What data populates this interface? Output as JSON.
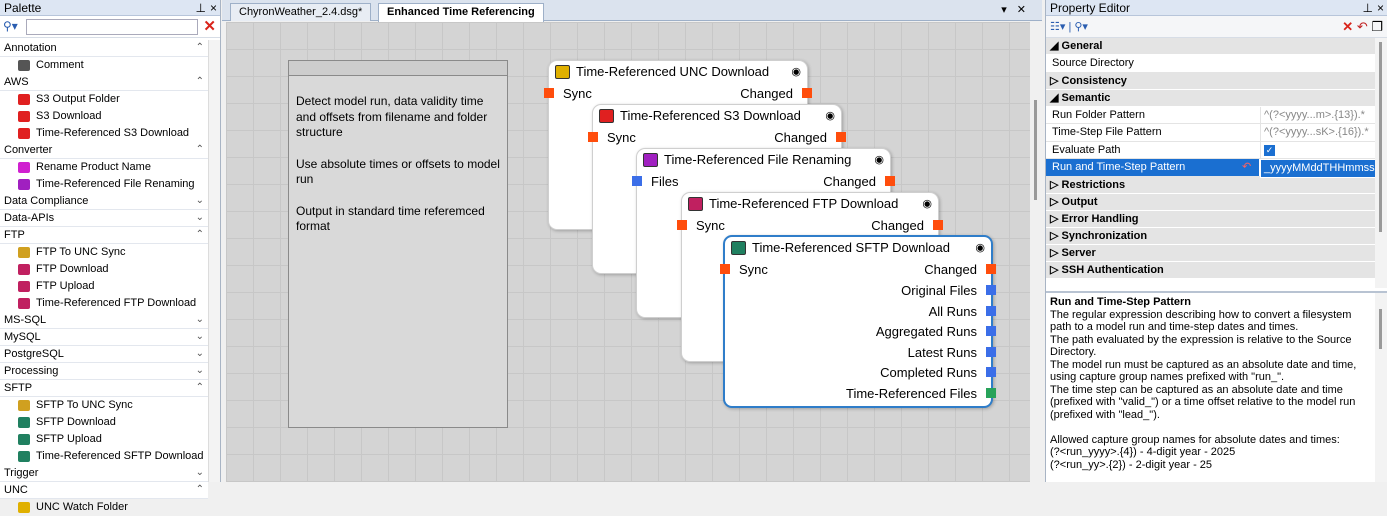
{
  "palette": {
    "title": "Palette",
    "search_placeholder": "",
    "categories": [
      {
        "name": "Annotation",
        "expanded": true,
        "items": [
          {
            "label": "Comment",
            "icon": "comment-icon",
            "color": "#555555"
          }
        ]
      },
      {
        "name": "AWS",
        "expanded": true,
        "items": [
          {
            "label": "S3 Output Folder",
            "icon": "s3-output-icon",
            "color": "#e02020"
          },
          {
            "label": "S3 Download",
            "icon": "s3-download-icon",
            "color": "#e02020"
          },
          {
            "label": "Time-Referenced S3 Download",
            "icon": "s3-time-icon",
            "color": "#e02020"
          }
        ]
      },
      {
        "name": "Converter",
        "expanded": true,
        "items": [
          {
            "label": "Rename Product Name",
            "icon": "rename-icon",
            "color": "#d020d0"
          },
          {
            "label": "Time-Referenced File Renaming",
            "icon": "rename-time-icon",
            "color": "#a020c0"
          }
        ]
      },
      {
        "name": "Data Compliance",
        "expanded": false,
        "items": []
      },
      {
        "name": "Data-APIs",
        "expanded": false,
        "items": []
      },
      {
        "name": "FTP",
        "expanded": true,
        "items": [
          {
            "label": "FTP To UNC Sync",
            "icon": "ftp-sync-icon",
            "color": "#d0a020"
          },
          {
            "label": "FTP Download",
            "icon": "ftp-download-icon",
            "color": "#c02060"
          },
          {
            "label": "FTP Upload",
            "icon": "ftp-upload-icon",
            "color": "#c02060"
          },
          {
            "label": "Time-Referenced FTP Download",
            "icon": "ftp-time-icon",
            "color": "#c02060"
          }
        ]
      },
      {
        "name": "MS-SQL",
        "expanded": false,
        "items": []
      },
      {
        "name": "MySQL",
        "expanded": false,
        "items": []
      },
      {
        "name": "PostgreSQL",
        "expanded": false,
        "items": []
      },
      {
        "name": "Processing",
        "expanded": false,
        "items": []
      },
      {
        "name": "SFTP",
        "expanded": true,
        "items": [
          {
            "label": "SFTP To UNC Sync",
            "icon": "sftp-sync-icon",
            "color": "#d0a020"
          },
          {
            "label": "SFTP Download",
            "icon": "sftp-download-icon",
            "color": "#208060"
          },
          {
            "label": "SFTP Upload",
            "icon": "sftp-upload-icon",
            "color": "#208060"
          },
          {
            "label": "Time-Referenced SFTP Download",
            "icon": "sftp-time-icon",
            "color": "#208060"
          }
        ]
      },
      {
        "name": "Trigger",
        "expanded": false,
        "items": []
      },
      {
        "name": "UNC",
        "expanded": true,
        "items": [
          {
            "label": "UNC Watch Folder",
            "icon": "unc-watch-icon",
            "color": "#e0b000"
          }
        ]
      }
    ]
  },
  "tabs": [
    {
      "label": "ChyronWeather_2.4.dsg*",
      "active": false
    },
    {
      "label": "Enhanced Time Referencing",
      "active": true
    }
  ],
  "comment": {
    "paragraphs": [
      "Detect model run, data validity time and offsets from filename and folder structure",
      "Use absolute times or offsets to model run",
      "Output in standard time referemced format"
    ]
  },
  "nodes": [
    {
      "title": "Time-Referenced UNC Download",
      "icon_color": "#e0b000",
      "in": {
        "label": "Sync",
        "color": "#ff4d0c"
      },
      "out": "Changed"
    },
    {
      "title": "Time-Referenced S3 Download",
      "icon_color": "#e02020",
      "in": {
        "label": "Sync",
        "color": "#ff4d0c"
      },
      "out": "Changed"
    },
    {
      "title": "Time-Referenced File Renaming",
      "icon_color": "#a020c0",
      "in": {
        "label": "Files",
        "color": "#3b6ee8"
      },
      "out": "Changed"
    },
    {
      "title": "Time-Referenced FTP Download",
      "icon_color": "#c02060",
      "in": {
        "label": "Sync",
        "color": "#ff4d0c"
      },
      "out": "Changed"
    },
    {
      "title": "Time-Referenced SFTP Download",
      "icon_color": "#208060",
      "in": {
        "label": "Sync",
        "color": "#ff4d0c"
      },
      "out": "Changed",
      "extra_outputs": [
        "Original Files",
        "All Runs",
        "Aggregated Runs",
        "Latest Runs",
        "Completed Runs",
        "Time-Referenced Files"
      ]
    }
  ],
  "property_editor": {
    "title": "Property Editor",
    "rows": [
      {
        "type": "cat",
        "label": "General",
        "expanded": true
      },
      {
        "type": "prop",
        "label": "Source Directory",
        "value": ""
      },
      {
        "type": "cat",
        "label": "Consistency",
        "expanded": false
      },
      {
        "type": "cat",
        "label": "Semantic",
        "expanded": true
      },
      {
        "type": "prop",
        "label": "Run Folder Pattern",
        "value": "^(?<yyyy...m>.{13}).*"
      },
      {
        "type": "prop",
        "label": "Time-Step File Pattern",
        "value": "^(?<yyyy...sK>.{16}).*"
      },
      {
        "type": "prop",
        "label": "Evaluate Path",
        "value": "",
        "checkbox": true
      },
      {
        "type": "prop",
        "label": "Run and Time-Step Pattern",
        "value": "_yyyyMMddTHHmmssK",
        "selected": true
      },
      {
        "type": "cat",
        "label": "Restrictions",
        "expanded": false
      },
      {
        "type": "cat",
        "label": "Output",
        "expanded": false
      },
      {
        "type": "cat",
        "label": "Error Handling",
        "expanded": false
      },
      {
        "type": "cat",
        "label": "Synchronization",
        "expanded": false
      },
      {
        "type": "cat",
        "label": "Server",
        "expanded": false
      },
      {
        "type": "cat",
        "label": "SSH Authentication",
        "expanded": false
      }
    ],
    "description": {
      "title": "Run and Time-Step Pattern",
      "lines": [
        "The regular expression describing how to convert a filesystem path to a model run and time-step dates and times.",
        "The path evaluated by the expression is relative to the Source Directory.",
        "The model run must be captured as an absolute date and time, using capture group names prefixed with \"run_\".",
        "The time step can be captured as an absolute date and time (prefixed with \"valid_\") or a time offset relative to the model run (prefixed with \"lead_\").",
        "",
        "Allowed capture group names for absolute dates and times:",
        "(?<run_yyyy>.{4}) - 4-digit year - 2025",
        "(?<run_yy>.{2}) - 2-digit year - 25"
      ]
    }
  }
}
